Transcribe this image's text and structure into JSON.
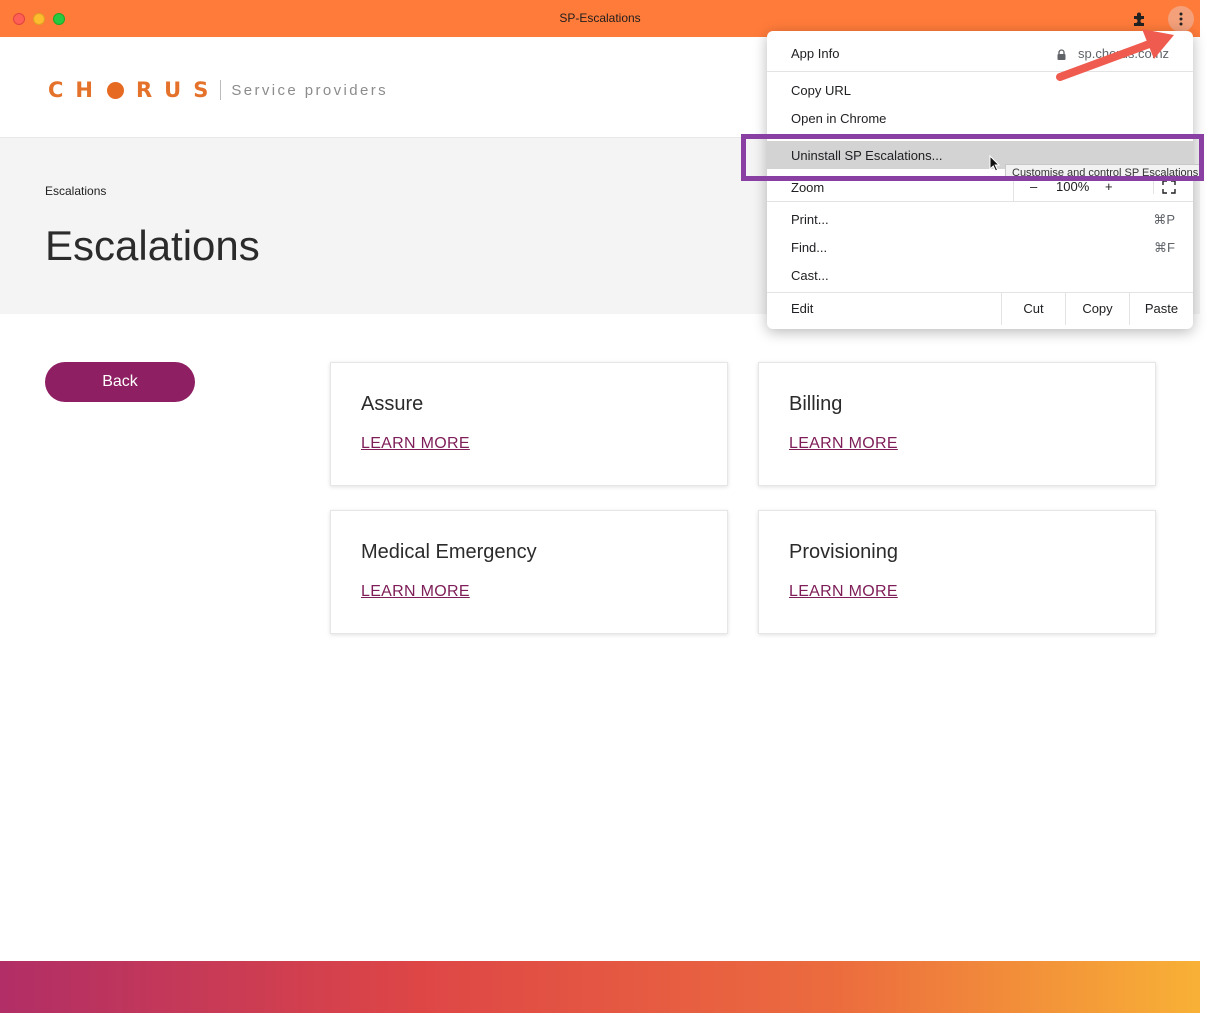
{
  "window": {
    "title": "SP-Escalations"
  },
  "header": {
    "logo_word_left": "CH",
    "logo_word_right": "RUS",
    "logo_subtitle": "Service providers"
  },
  "band": {
    "breadcrumb": "Escalations",
    "title": "Escalations"
  },
  "back_label": "Back",
  "cards": [
    {
      "title": "Assure",
      "link": "LEARN MORE"
    },
    {
      "title": "Billing",
      "link": "LEARN MORE"
    },
    {
      "title": "Medical Emergency",
      "link": "LEARN MORE"
    },
    {
      "title": "Provisioning",
      "link": "LEARN MORE"
    }
  ],
  "menu": {
    "app_info": "App Info",
    "url": "sp.chorus.co.nz",
    "copy_url": "Copy URL",
    "open_chrome": "Open in Chrome",
    "uninstall": "Uninstall SP Escalations...",
    "zoom": "Zoom",
    "zoom_minus": "–",
    "zoom_value": "100%",
    "zoom_plus": "+",
    "print": "Print...",
    "print_shortcut": "⌘P",
    "find": "Find...",
    "find_shortcut": "⌘F",
    "cast": "Cast...",
    "edit": "Edit",
    "cut": "Cut",
    "copy": "Copy",
    "paste": "Paste"
  },
  "tooltip": "Customise and control SP Escalations",
  "colors": {
    "titlebar": "#ff7b3a",
    "brand_purple": "#8e1f62",
    "annotation_purple": "#8a3fa3",
    "annotation_arrow": "#ef5b4f"
  },
  "icons": {
    "extensions": "puzzle-icon",
    "menu": "kebab-menu-icon",
    "lock": "lock-icon",
    "fullscreen": "fullscreen-icon"
  }
}
